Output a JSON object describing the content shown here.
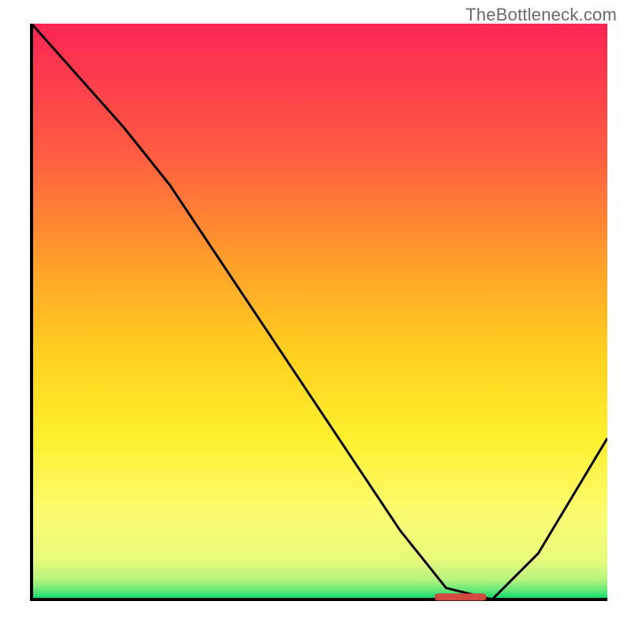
{
  "watermark": "TheBottleneck.com",
  "chart_data": {
    "type": "line",
    "title": "",
    "xlabel": "",
    "ylabel": "",
    "xlim": [
      0,
      100
    ],
    "ylim": [
      0,
      100
    ],
    "grid": false,
    "legend_position": "none",
    "series": [
      {
        "name": "curve",
        "x": [
          0,
          8,
          16,
          24,
          32,
          40,
          48,
          56,
          64,
          72,
          80,
          88,
          100
        ],
        "values": [
          100,
          91,
          82,
          72,
          60,
          48,
          36,
          24,
          12,
          2,
          0,
          8,
          28
        ]
      }
    ],
    "marker": {
      "x_start": 70,
      "x_end": 79,
      "y": 0.5
    },
    "colors": {
      "gradient_top": "#fc2555",
      "gradient_upper": "#ff6a3c",
      "gradient_mid": "#ffc223",
      "gradient_low": "#fbfb54",
      "gradient_bottom": "#00e06a",
      "curve": "#000000",
      "axis": "#000000",
      "marker": "#d34a3f",
      "watermark": "#6a6a6a"
    }
  }
}
